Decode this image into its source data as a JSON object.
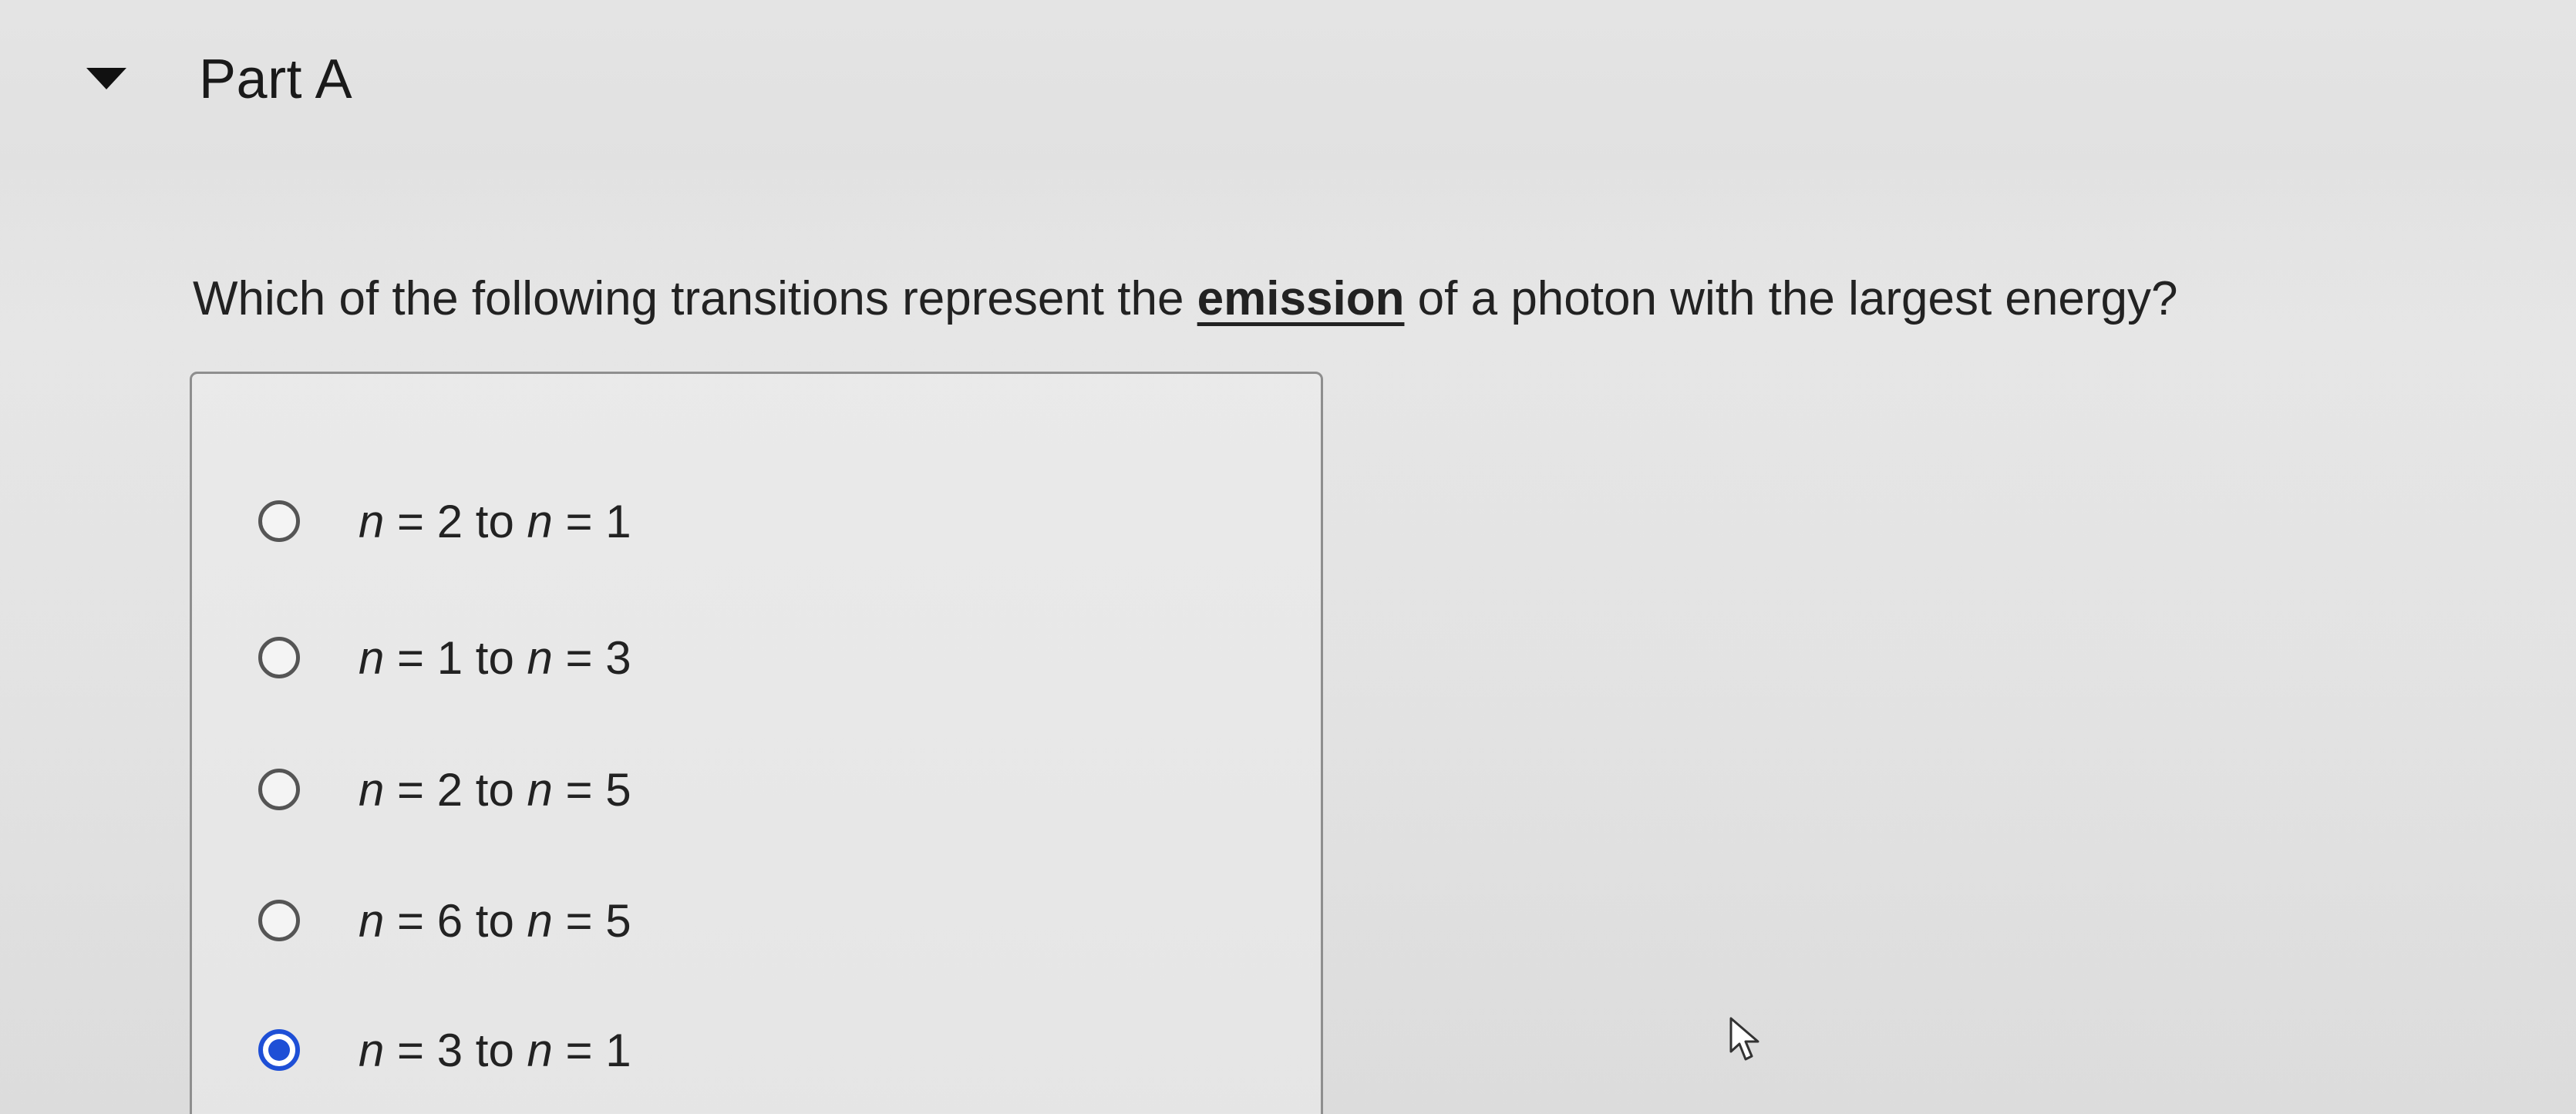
{
  "part": {
    "title": "Part A",
    "expanded": true
  },
  "question": {
    "before": "Which of the following transitions represent the ",
    "emphasis": "emission",
    "after": " of a photon with the largest energy?"
  },
  "choices": [
    {
      "var1": "n",
      "from_text": " = 2 to ",
      "var2": "n",
      "to_text": " = 1",
      "selected": false
    },
    {
      "var1": "n",
      "from_text": " = 1 to ",
      "var2": "n",
      "to_text": " = 3",
      "selected": false
    },
    {
      "var1": "n",
      "from_text": " = 2 to ",
      "var2": "n",
      "to_text": " = 5",
      "selected": false
    },
    {
      "var1": "n",
      "from_text": " = 6 to ",
      "var2": "n",
      "to_text": " = 5",
      "selected": false
    },
    {
      "var1": "n",
      "from_text": " = 3 to ",
      "var2": "n",
      "to_text": " = 1",
      "selected": true
    }
  ],
  "colors": {
    "accent": "#1e4fd6",
    "background": "#e3e3e3",
    "text": "#222222"
  },
  "icons": {
    "toggle": "caret-down-icon",
    "pointer": "mouse-pointer-icon"
  }
}
